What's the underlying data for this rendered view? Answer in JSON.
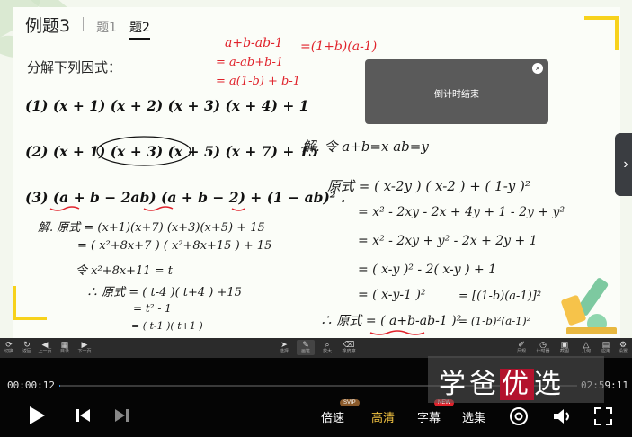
{
  "slide": {
    "tabs": {
      "main": "例题3",
      "tab1": "题1",
      "tab2": "题2"
    },
    "instruction": "分解下列因式：",
    "problems": [
      "(1) (x + 1) (x + 2) (x + 3) (x + 4) + 1",
      "(2) (x + 1) (x + 3) (x + 5) (x + 7) + 15",
      "(3) (a + b − 2ab) (a + b − 2) + (1 − ab)² ."
    ],
    "handwriting_red": {
      "r1": "a+b-ab-1",
      "r2": "=(1+b)(a-1)",
      "r3": "= a-ab+b-1",
      "r4": "= a(1-b) + b-1"
    },
    "handwriting_black": {
      "sol_head": "解. 令 a+b=x    ab=y",
      "s1": "原式 = ( x-2y ) ( x-2 ) + ( 1-y )²",
      "s2": "= x² - 2xy - 2x + 4y + 1 - 2y + y²",
      "s3": "= x² - 2xy + y² - 2x + 2y + 1",
      "s4": "= ( x-y )² - 2( x-y ) + 1",
      "s5": "= ( x-y-1 )²",
      "s6": "∴ 原式 = ( a+b-ab-1 )²",
      "s7": "= [(1-b)(a-1)]²",
      "s8": "= (1-b)²(a-1)²",
      "l1": "解. 原式 = (x+1)(x+7) (x+3)(x+5) + 15",
      "l2": "= ( x²+8x+7 ) ( x²+8x+15 ) + 15",
      "l3": "令  x²+8x+11 = t",
      "l4": "∴ 原式 = ( t-4 )( t+4 ) +15",
      "l5": "= t² - 1",
      "l6": "= ( t-1 )( t+1 )"
    },
    "popup": {
      "text": "倒计时结束",
      "close": "×"
    }
  },
  "toolbar": {
    "left": [
      {
        "icon": "refresh-icon",
        "glyph": "⟳",
        "label": "切换"
      },
      {
        "icon": "reset-icon",
        "glyph": "↻",
        "label": "返回"
      },
      {
        "icon": "prev-icon",
        "glyph": "◀",
        "label": "上一页"
      },
      {
        "icon": "catalog-icon",
        "glyph": "▦",
        "label": "目录"
      },
      {
        "icon": "next-icon",
        "glyph": "▶",
        "label": "下一页"
      }
    ],
    "center": [
      {
        "icon": "select-icon",
        "glyph": "➤",
        "label": "选择"
      },
      {
        "icon": "pen-icon",
        "glyph": "✎",
        "label": "画笔"
      },
      {
        "icon": "zoom-icon",
        "glyph": "⌕",
        "label": "放大"
      },
      {
        "icon": "eraser-icon",
        "glyph": "⌫",
        "label": "橡皮擦"
      }
    ],
    "right": [
      {
        "icon": "ruler-icon",
        "glyph": "✐",
        "label": "尺规"
      },
      {
        "icon": "timer-icon",
        "glyph": "◷",
        "label": "计时器"
      },
      {
        "icon": "screenshot-icon",
        "glyph": "▣",
        "label": "截图"
      },
      {
        "icon": "geometry-icon",
        "glyph": "△",
        "label": "几何"
      },
      {
        "icon": "app-icon",
        "glyph": "▤",
        "label": "应用"
      },
      {
        "icon": "settings-icon",
        "glyph": "⚙",
        "label": "设置"
      }
    ]
  },
  "player": {
    "current_time": "00:00:12",
    "total_time": "02:59:11",
    "progress": 0.001,
    "speed_label": "倍速",
    "speed_badge": "SVIP",
    "quality_label": "高清",
    "subtitle_label": "字幕",
    "subtitle_badge": "NEW",
    "episodes_label": "选集",
    "watermark": "学爸优选"
  },
  "colors": {
    "accent_yellow": "#f7d21c",
    "ink_red": "#e0222b",
    "progress_blue": "#3a8dde",
    "quality_gold": "#f0c040"
  }
}
